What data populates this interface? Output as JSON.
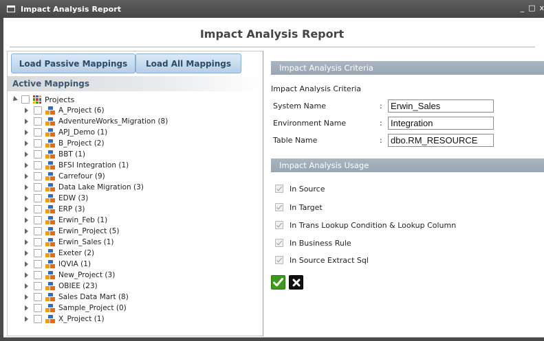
{
  "window": {
    "title": "Impact Analysis Report",
    "controls": {
      "minimize": "_",
      "maximize": "□",
      "close": "x"
    }
  },
  "report_title": "Impact Analysis Report",
  "left_panel": {
    "buttons": {
      "load_passive": "Load Passive Mappings",
      "load_all": "Load All Mappings"
    },
    "active_mappings_header": "Active Mappings",
    "tree": {
      "root_label": "Projects",
      "items": [
        {
          "label": "A_Project (6)"
        },
        {
          "label": "AdventureWorks_Migration (8)"
        },
        {
          "label": "APJ_Demo (1)"
        },
        {
          "label": "B_Project (2)"
        },
        {
          "label": "BBT (1)"
        },
        {
          "label": "BFSI Integration (1)"
        },
        {
          "label": "Carrefour (9)"
        },
        {
          "label": "Data Lake Migration (3)"
        },
        {
          "label": "EDW (3)"
        },
        {
          "label": "ERP (3)"
        },
        {
          "label": "Erwin_Feb (1)"
        },
        {
          "label": "Erwin_Project (5)"
        },
        {
          "label": "Erwin_Sales (1)"
        },
        {
          "label": "Exeter (2)"
        },
        {
          "label": "IQVIA (1)"
        },
        {
          "label": "New_Project (3)"
        },
        {
          "label": "OBIEE (23)"
        },
        {
          "label": "Sales Data Mart (8)"
        },
        {
          "label": "Sample_Project (0)"
        },
        {
          "label": "X_Project (1)"
        }
      ]
    }
  },
  "right_panel": {
    "criteria_header": "Impact Analysis Criteria",
    "criteria_subtitle": "Impact Analysis Criteria",
    "fields": {
      "system_name": {
        "label": "System Name",
        "colon": ":",
        "value": "Erwin_Sales"
      },
      "environment_name": {
        "label": "Environment Name",
        "colon": ":",
        "value": "Integration"
      },
      "table_name": {
        "label": "Table Name",
        "colon": ":",
        "value": "dbo.RM_RESOURCE"
      }
    },
    "usage_header": "Impact Analysis Usage",
    "usage_options": [
      {
        "label": "In Source",
        "checked": true
      },
      {
        "label": "In Target",
        "checked": true
      },
      {
        "label": "In Trans Lookup Condition & Lookup Column",
        "checked": true
      },
      {
        "label": "In Business Rule",
        "checked": true
      },
      {
        "label": "In Source Extract Sql",
        "checked": true
      }
    ]
  },
  "colors": {
    "titlebar": "#4f4f4f",
    "button_gradient_top": "#dbe9f7",
    "button_text": "#2d4a68",
    "section_header": "#a2afbb",
    "ok_green": "#3e9a1c",
    "project_icon_blue": "#2d6fb6",
    "project_icon_orange": "#f09a1a"
  }
}
